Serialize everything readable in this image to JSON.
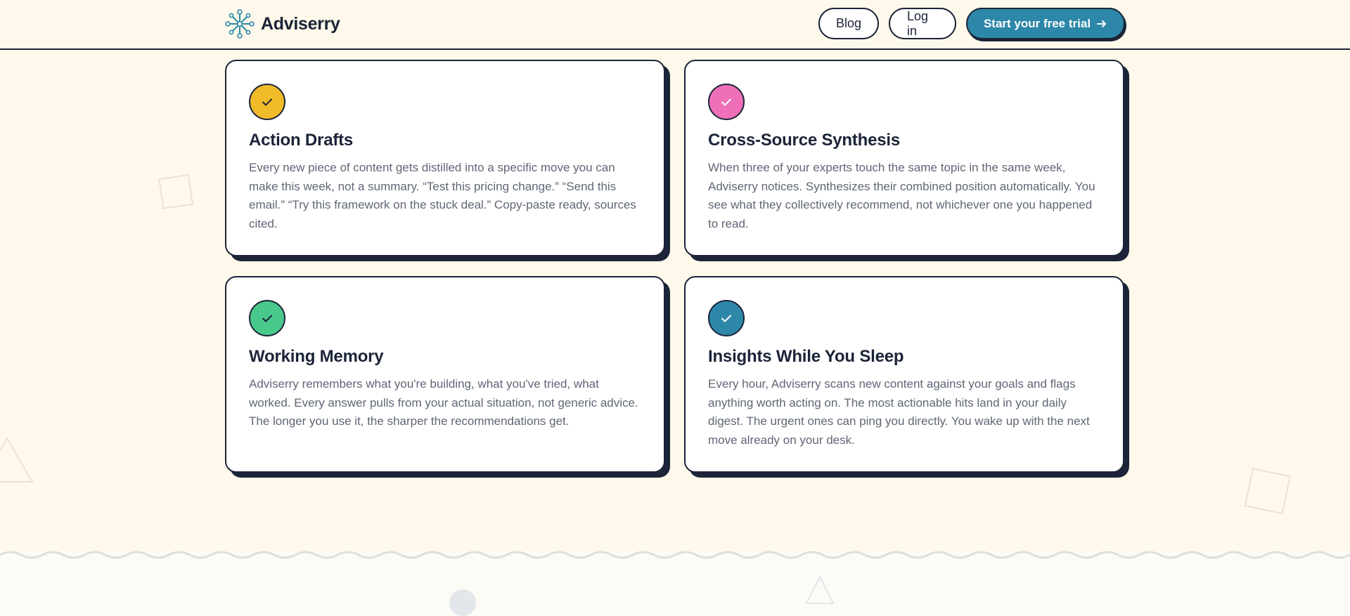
{
  "brand": {
    "name": "Adviserry",
    "accent": "#2d87a9"
  },
  "nav": {
    "blog_label": "Blog",
    "login_label": "Log in",
    "cta_label": "Start your free trial",
    "cta_icon": "arrow-right-icon"
  },
  "cards": [
    {
      "title": "Action Drafts",
      "body": "Every new piece of content gets distilled into a specific move you can make this week, not a summary. “Test this pricing change.” “Send this email.” “Try this framework on the stuck deal.” Copy-paste ready, sources cited.",
      "icon": "check-icon",
      "icon_color": "#f1bb29",
      "check_color": "#1b2438"
    },
    {
      "title": "Cross-Source Synthesis",
      "body": "When three of your experts touch the same topic in the same week, Adviserry notices. Synthesizes their combined position automatically. You see what they collectively recommend, not whichever one you happened to read.",
      "icon": "check-icon",
      "icon_color": "#ef6fb8",
      "check_color": "#ffffff"
    },
    {
      "title": "Working Memory",
      "body": "Adviserry remembers what you're building, what you've tried, what worked. Every answer pulls from your actual situation, not generic advice. The longer you use it, the sharper the recommendations get.",
      "icon": "check-icon",
      "icon_color": "#48c98b",
      "check_color": "#1b2438"
    },
    {
      "title": "Insights While You Sleep",
      "body": "Every hour, Adviserry scans new content against your goals and flags anything worth acting on. The most actionable hits land in your daily digest. The urgent ones can ping you directly. You wake up with the next move already on your desk.",
      "icon": "check-icon",
      "icon_color": "#2d87a9",
      "check_color": "#ffffff"
    }
  ]
}
